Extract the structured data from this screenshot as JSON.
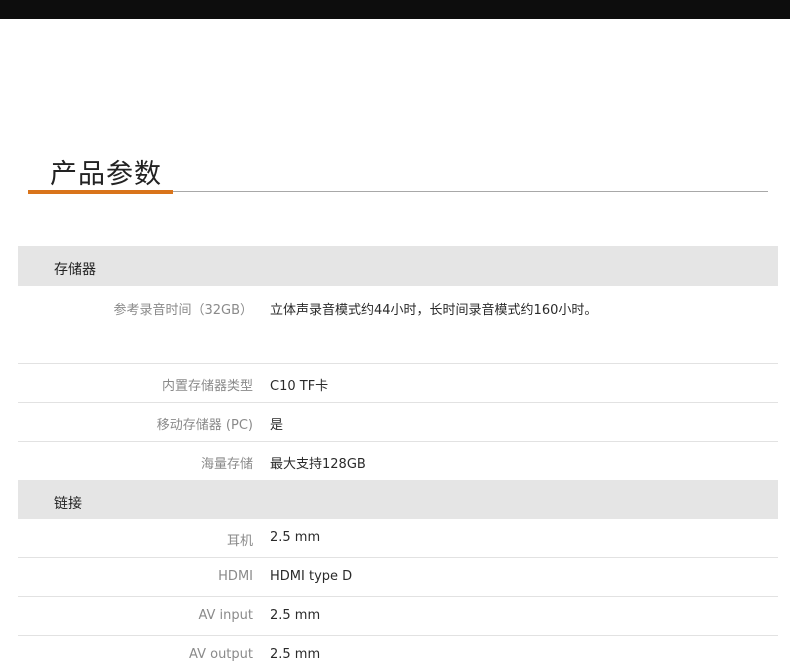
{
  "page": {
    "title": "产品参数",
    "accent_color": "#d9741b",
    "header_bg": "#e5e5e5"
  },
  "groups": [
    {
      "name": "存储器",
      "rows": [
        {
          "label": "参考录音时间（32GB）",
          "value": "立体声录音模式约44小时，长时间录音模式约160小时。"
        },
        {
          "label": "内置存储器类型",
          "value": "C10 TF卡"
        },
        {
          "label": "移动存储器 (PC)",
          "value": "是"
        },
        {
          "label": "海量存储",
          "value": "最大支持128GB"
        }
      ]
    },
    {
      "name": "链接",
      "rows": [
        {
          "label": "耳机",
          "value": " 2.5 mm"
        },
        {
          "label": "HDMI",
          "value": "HDMI type D"
        },
        {
          "label": "AV input",
          "value": "2.5 mm"
        },
        {
          "label": "AV output",
          "value": "2.5 mm"
        }
      ]
    }
  ]
}
